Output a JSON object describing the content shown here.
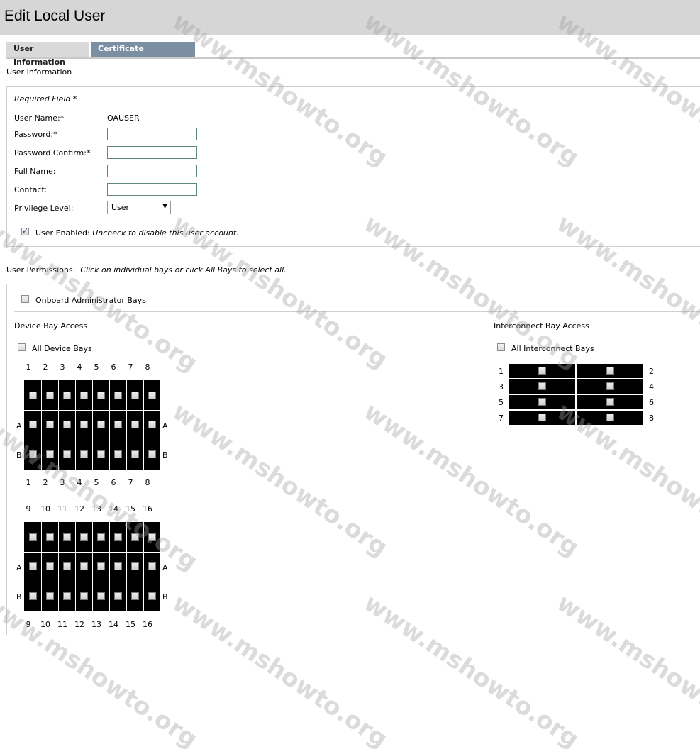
{
  "header": {
    "title": "Edit Local User"
  },
  "tabs": [
    {
      "label": "User Information",
      "active": true
    },
    {
      "label": "Certificate Information",
      "active": false
    }
  ],
  "section_user_info": {
    "title": "User Information"
  },
  "form": {
    "required_note": "Required Field *",
    "username_label": "User Name:*",
    "username_value": "OAUSER",
    "password_label": "Password:*",
    "password_confirm_label": "Password Confirm:*",
    "fullname_label": "Full Name:",
    "contact_label": "Contact:",
    "privilege_label": "Privilege Level:",
    "privilege_value": "User",
    "enabled_label": "User Enabled:",
    "enabled_hint": "Uncheck to disable this user account.",
    "enabled_checked": true
  },
  "permissions": {
    "label": "User Permissions:",
    "hint": "Click on individual bays or click All Bays to select all.",
    "oa_bays_label": "Onboard Administrator Bays",
    "device_bay_title": "Device Bay Access",
    "all_device_label": "All Device Bays",
    "interconnect_title": "Interconnect Bay Access",
    "all_interconnect_label": "All Interconnect Bays",
    "row_a": "A",
    "row_b": "B",
    "device_cols_1": [
      "1",
      "2",
      "3",
      "4",
      "5",
      "6",
      "7",
      "8"
    ],
    "device_cols_2": [
      "9",
      "10",
      "11",
      "12",
      "13",
      "14",
      "15",
      "16"
    ],
    "interconnect_left": [
      "1",
      "3",
      "5",
      "7"
    ],
    "interconnect_right": [
      "2",
      "4",
      "6",
      "8"
    ]
  },
  "watermark": "www.mshowto.org"
}
